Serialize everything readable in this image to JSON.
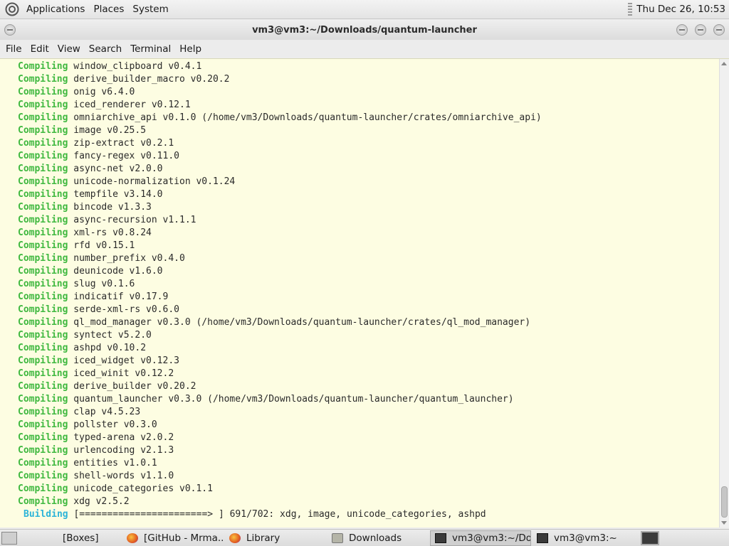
{
  "top_panel": {
    "menus": [
      "Applications",
      "Places",
      "System"
    ],
    "clock": "Thu Dec 26, 10:53"
  },
  "window": {
    "title": "vm3@vm3:~/Downloads/quantum-launcher"
  },
  "menubar": [
    "File",
    "Edit",
    "View",
    "Search",
    "Terminal",
    "Help"
  ],
  "terminal": {
    "lines": [
      {
        "kw": "Compiling",
        "text": "window_clipboard v0.4.1"
      },
      {
        "kw": "Compiling",
        "text": "derive_builder_macro v0.20.2"
      },
      {
        "kw": "Compiling",
        "text": "onig v6.4.0"
      },
      {
        "kw": "Compiling",
        "text": "iced_renderer v0.12.1"
      },
      {
        "kw": "Compiling",
        "text": "omniarchive_api v0.1.0 (/home/vm3/Downloads/quantum-launcher/crates/omniarchive_api)"
      },
      {
        "kw": "Compiling",
        "text": "image v0.25.5"
      },
      {
        "kw": "Compiling",
        "text": "zip-extract v0.2.1"
      },
      {
        "kw": "Compiling",
        "text": "fancy-regex v0.11.0"
      },
      {
        "kw": "Compiling",
        "text": "async-net v2.0.0"
      },
      {
        "kw": "Compiling",
        "text": "unicode-normalization v0.1.24"
      },
      {
        "kw": "Compiling",
        "text": "tempfile v3.14.0"
      },
      {
        "kw": "Compiling",
        "text": "bincode v1.3.3"
      },
      {
        "kw": "Compiling",
        "text": "async-recursion v1.1.1"
      },
      {
        "kw": "Compiling",
        "text": "xml-rs v0.8.24"
      },
      {
        "kw": "Compiling",
        "text": "rfd v0.15.1"
      },
      {
        "kw": "Compiling",
        "text": "number_prefix v0.4.0"
      },
      {
        "kw": "Compiling",
        "text": "deunicode v1.6.0"
      },
      {
        "kw": "Compiling",
        "text": "slug v0.1.6"
      },
      {
        "kw": "Compiling",
        "text": "indicatif v0.17.9"
      },
      {
        "kw": "Compiling",
        "text": "serde-xml-rs v0.6.0"
      },
      {
        "kw": "Compiling",
        "text": "ql_mod_manager v0.3.0 (/home/vm3/Downloads/quantum-launcher/crates/ql_mod_manager)"
      },
      {
        "kw": "Compiling",
        "text": "syntect v5.2.0"
      },
      {
        "kw": "Compiling",
        "text": "ashpd v0.10.2"
      },
      {
        "kw": "Compiling",
        "text": "iced_widget v0.12.3"
      },
      {
        "kw": "Compiling",
        "text": "iced_winit v0.12.2"
      },
      {
        "kw": "Compiling",
        "text": "derive_builder v0.20.2"
      },
      {
        "kw": "Compiling",
        "text": "quantum_launcher v0.3.0 (/home/vm3/Downloads/quantum-launcher/quantum_launcher)"
      },
      {
        "kw": "Compiling",
        "text": "clap v4.5.23"
      },
      {
        "kw": "Compiling",
        "text": "pollster v0.3.0"
      },
      {
        "kw": "Compiling",
        "text": "typed-arena v2.0.2"
      },
      {
        "kw": "Compiling",
        "text": "urlencoding v2.1.3"
      },
      {
        "kw": "Compiling",
        "text": "entities v1.0.1"
      },
      {
        "kw": "Compiling",
        "text": "shell-words v1.1.0"
      },
      {
        "kw": "Compiling",
        "text": "unicode_categories v0.1.1"
      },
      {
        "kw": "Compiling",
        "text": "xdg v2.5.2"
      }
    ],
    "status_kw": "Building",
    "status_text": "[=======================> ] 691/702: xdg, image, unicode_categories, ashpd"
  },
  "taskbar": {
    "tasks": [
      {
        "label": "[Boxes]",
        "icon": "none"
      },
      {
        "label": "[GitHub - Mrma...",
        "icon": "firefox-icon"
      },
      {
        "label": "Library",
        "icon": "firefox-icon"
      },
      {
        "label": "Downloads",
        "icon": "folder-icon"
      },
      {
        "label": "vm3@vm3:~/Do...",
        "icon": "terminal-icon",
        "active": true
      },
      {
        "label": "vm3@vm3:~",
        "icon": "terminal-icon"
      }
    ]
  }
}
